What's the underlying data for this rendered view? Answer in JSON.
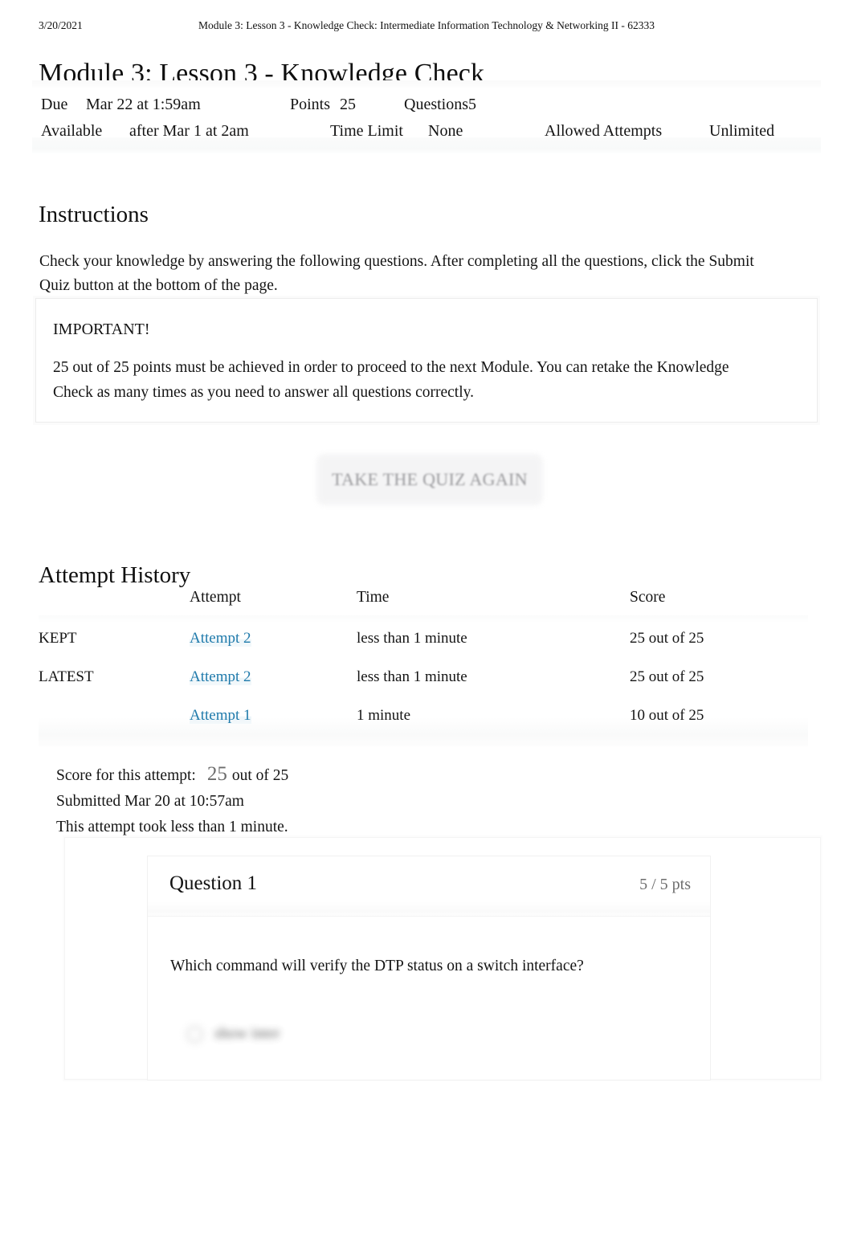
{
  "print_header": {
    "date": "3/20/2021",
    "title": "Module 3: Lesson 3 - Knowledge Check: Intermediate Information Technology & Networking II - 62333"
  },
  "page_title": "Module 3: Lesson 3 - Knowledge Check",
  "quiz_meta": {
    "due_label": "Due",
    "due_value": "Mar 22 at 1:59am",
    "points_label": "Points",
    "points_value": "25",
    "questions_label": "Questions",
    "questions_value": "5",
    "available_label": "Available",
    "available_value": "after Mar 1 at 2am",
    "time_limit_label": "Time Limit",
    "time_limit_value": "None",
    "allowed_attempts_label": "Allowed Attempts",
    "allowed_attempts_value": "Unlimited"
  },
  "instructions": {
    "heading": "Instructions",
    "body": "Check your knowledge by answering the following questions. After completing all the questions, click the Submit Quiz button at the bottom of the page."
  },
  "important": {
    "title": "IMPORTANT!",
    "text": "25 out of 25 points must be achieved in order to proceed to the next Module. You can retake the Knowledge Check as many times as you need to answer all questions correctly."
  },
  "retake_button": {
    "label": "TAKE THE QUIZ AGAIN"
  },
  "attempt_history": {
    "heading": "Attempt History",
    "columns": [
      "",
      "Attempt",
      "Time",
      "Score"
    ],
    "rows": [
      {
        "tag": "KEPT",
        "attempt": "Attempt 2",
        "time": "less than 1 minute",
        "score": "25 out of 25"
      },
      {
        "tag": "LATEST",
        "attempt": "Attempt 2",
        "time": "less than 1 minute",
        "score": "25 out of 25"
      },
      {
        "tag": "",
        "attempt": "Attempt 1",
        "time": "1 minute",
        "score": "10 out of 25"
      }
    ]
  },
  "score_summary": {
    "score_label": "Score for this attempt:",
    "score_value": "25",
    "score_outof": "out of 25",
    "submitted": "Submitted Mar 20 at 10:57am",
    "duration": "This attempt took less than 1 minute."
  },
  "question": {
    "title": "Question 1",
    "points": "5 / 5 pts",
    "text": "Which command will verify the DTP status on a switch interface?",
    "answer_option_obscured": "show inter"
  },
  "colors": {
    "link_blue": "#1f7aab",
    "muted_gray": "#6d6d6d",
    "body_text": "#141414"
  }
}
